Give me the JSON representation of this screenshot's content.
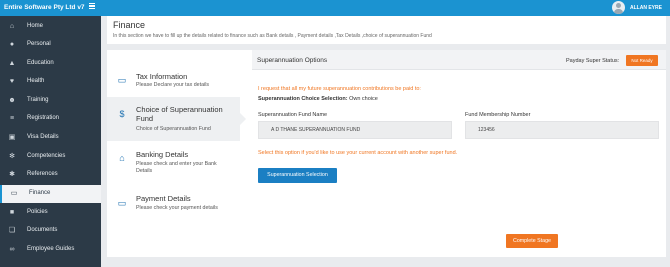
{
  "app": {
    "title": "Entire Software Pty Ltd v7",
    "user_name": "ALLAN EYRE"
  },
  "sidebar": {
    "items": [
      {
        "label": "Home",
        "icon": "home-icon"
      },
      {
        "label": "Personal",
        "icon": "user-icon"
      },
      {
        "label": "Education",
        "icon": "graduation-cap-icon"
      },
      {
        "label": "Health",
        "icon": "heart-icon"
      },
      {
        "label": "Training",
        "icon": "users-icon"
      },
      {
        "label": "Registration",
        "icon": "list-icon"
      },
      {
        "label": "Visa Details",
        "icon": "passport-icon"
      },
      {
        "label": "Competencies",
        "icon": "gears-icon"
      },
      {
        "label": "References",
        "icon": "references-icon"
      },
      {
        "label": "Finance",
        "icon": "money-icon",
        "active": true
      },
      {
        "label": "Policies",
        "icon": "briefcase-icon"
      },
      {
        "label": "Documents",
        "icon": "documents-icon"
      },
      {
        "label": "Employee Guides",
        "icon": "guides-icon"
      }
    ]
  },
  "header": {
    "title": "Finance",
    "description": "In this section we have to fill up the details related to finance such as Bank details , Payment details ,Tax Details ,choice of superannuation Fund"
  },
  "steps": [
    {
      "title": "Tax Information",
      "desc": "Please Declare your tax details",
      "icon": "money-icon"
    },
    {
      "title": "Choice of Superannuation Fund",
      "desc": "Choice of Superannuation Fund",
      "icon": "dollar-icon",
      "active": true
    },
    {
      "title": "Banking Details",
      "desc": "Please check and enter your Bank Details",
      "icon": "bank-icon"
    },
    {
      "title": "Payment Details",
      "desc": "Please check your payment details",
      "icon": "money-icon"
    }
  ],
  "panel": {
    "title": "Superannuation Options",
    "status_label": "Payday Super Status:",
    "status_badge": "Not Ready",
    "request_text": "I request that all my future superannuation contributions be paid to:",
    "choice_label": "Superannuation Choice Selection:",
    "choice_value": "Own choice",
    "fund_name_label": "Superannuation Fund Name",
    "fund_name_value": "A D THANE SUPERANNUATION FUND",
    "membership_label": "Fund Membership Number",
    "membership_value": "123456",
    "hint_text": "Select this option if you'd like to use your current account with another super fund.",
    "selection_button": "Superannuation Selection",
    "complete_button": "Complete Stage"
  },
  "colors": {
    "topbar": "#1b93d1",
    "sidebar": "#2c3a47",
    "accent_orange": "#f07622",
    "button_blue": "#1b7fc3"
  }
}
